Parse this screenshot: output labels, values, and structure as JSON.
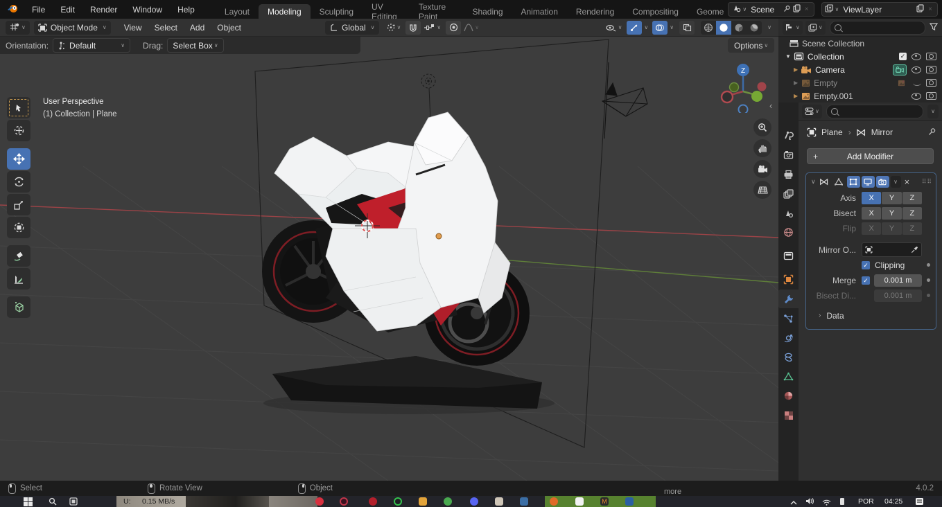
{
  "colors": {
    "accent": "#4772b3",
    "axis_x": "#a04347",
    "axis_y": "#6d8f40",
    "axis_z": "#3d6ba6",
    "select_orange": "#e09b4d"
  },
  "topbar": {
    "menus": [
      "File",
      "Edit",
      "Render",
      "Window",
      "Help"
    ],
    "tabs": [
      "Layout",
      "Modeling",
      "Sculpting",
      "UV Editing",
      "Texture Paint",
      "Shading",
      "Animation",
      "Rendering",
      "Compositing",
      "Geome"
    ],
    "active_tab": "Modeling",
    "scene_value": "Scene",
    "viewlayer_value": "ViewLayer"
  },
  "viewport_header": {
    "mode": "Object Mode",
    "menu_view": "View",
    "menu_select": "Select",
    "menu_add": "Add",
    "menu_object": "Object",
    "orientation": "Global"
  },
  "tool_settings": {
    "orientation_label": "Orientation:",
    "orientation_value": "Default",
    "drag_label": "Drag:",
    "drag_value": "Select Box",
    "options": "Options"
  },
  "viewport_overlay": {
    "line1": "User Perspective",
    "line2": "(1) Collection | Plane",
    "gizmo_z": "Z"
  },
  "outliner": {
    "row_scene_collection": "Scene Collection",
    "row_collection": "Collection",
    "row_camera": "Camera",
    "row_empty": "Empty",
    "row_empty001": "Empty.001"
  },
  "properties": {
    "breadcrumb_object": "Plane",
    "breadcrumb_modifier": "Mirror",
    "add_modifier": "Add Modifier",
    "mirror": {
      "axis_label": "Axis",
      "bisect_label": "Bisect",
      "flip_label": "Flip",
      "x": "X",
      "y": "Y",
      "z": "Z",
      "mirror_object_label": "Mirror O...",
      "clipping_label": "Clipping",
      "merge_label": "Merge",
      "merge_value": "0.001 m",
      "bisect_distance_label": "Bisect Di...",
      "bisect_distance_value": "0.001 m",
      "data_label": "Data"
    }
  },
  "statusbar": {
    "select": "Select",
    "rotate_view": "Rotate View",
    "object": "Object",
    "version": "4.0.2"
  },
  "taskbar": {
    "upload_label": "U:",
    "upload_value": "0.15 MB/s",
    "more": "more",
    "lang": "POR",
    "time": "04:25"
  }
}
